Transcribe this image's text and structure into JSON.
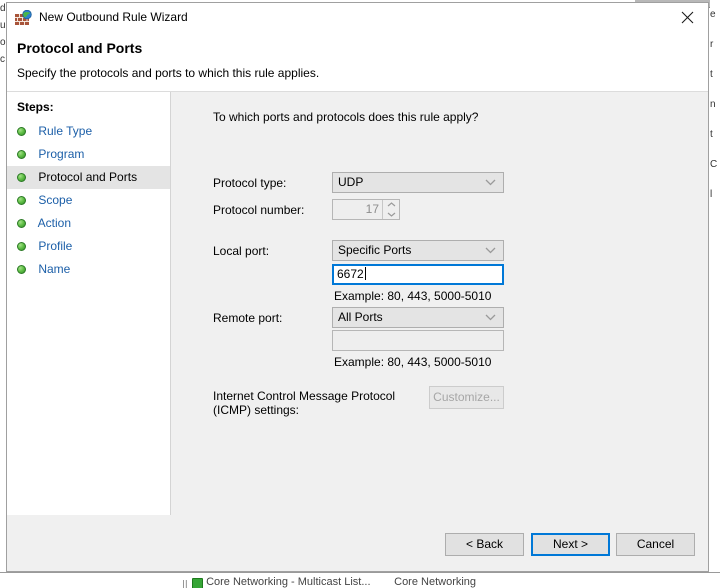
{
  "background": {
    "left_strip_chars": [
      "d",
      "u",
      "o",
      "c"
    ],
    "right_col_chars": [
      "e",
      "r",
      "t",
      "n",
      "t",
      "C",
      "l"
    ],
    "bottom_row": {
      "cells": [
        "Core Networking - Multicast List...",
        "Core Networking"
      ]
    }
  },
  "dialog": {
    "titlebar": {
      "icon": "firewall-globe-icon",
      "title": "New Outbound Rule Wizard",
      "close_label": "close-icon"
    },
    "header": {
      "title": "Protocol and Ports",
      "subtitle": "Specify the protocols and ports to which this rule applies."
    },
    "sidebar": {
      "heading": "Steps:",
      "items": [
        {
          "label": "Rule Type",
          "current": false
        },
        {
          "label": "Program",
          "current": false
        },
        {
          "label": "Protocol and Ports",
          "current": true
        },
        {
          "label": "Scope",
          "current": false
        },
        {
          "label": "Action",
          "current": false
        },
        {
          "label": "Profile",
          "current": false
        },
        {
          "label": "Name",
          "current": false
        }
      ]
    },
    "main": {
      "question": "To which ports and protocols does this rule apply?",
      "protocol_type": {
        "label": "Protocol type:",
        "value": "UDP"
      },
      "protocol_number": {
        "label": "Protocol number:",
        "value": "17"
      },
      "local_port": {
        "label": "Local port:",
        "value": "Specific Ports",
        "ports_value": "6672",
        "hint": "Example: 80, 443, 5000-5010"
      },
      "remote_port": {
        "label": "Remote port:",
        "value": "All Ports",
        "ports_value": "",
        "hint": "Example: 80, 443, 5000-5010"
      },
      "icmp": {
        "label_line1": "Internet Control Message Protocol",
        "label_line2": "(ICMP) settings:",
        "customize_label": "Customize..."
      }
    },
    "footer": {
      "back_label": "< Back",
      "next_label": "Next >",
      "cancel_label": "Cancel"
    }
  },
  "colors": {
    "accent": "#0078d7",
    "link": "#1c5fa8",
    "panel": "#f0f0f0",
    "selected_row": "#e4e4e4"
  }
}
